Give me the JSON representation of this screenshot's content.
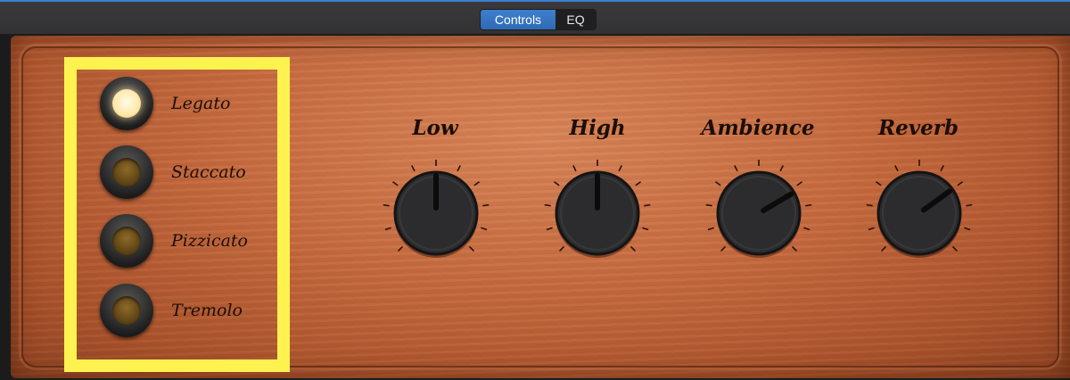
{
  "tabs": [
    {
      "label": "Controls",
      "active": true
    },
    {
      "label": "EQ",
      "active": false
    }
  ],
  "articulations": [
    {
      "label": "Legato",
      "on": true
    },
    {
      "label": "Staccato",
      "on": false
    },
    {
      "label": "Pizzicato",
      "on": false
    },
    {
      "label": "Tremolo",
      "on": false
    }
  ],
  "knobs": [
    {
      "label": "Low",
      "value": 0.5
    },
    {
      "label": "High",
      "value": 0.5
    },
    {
      "label": "Ambience",
      "value": 0.72
    },
    {
      "label": "Reverb",
      "value": 0.7
    }
  ],
  "colors": {
    "highlight": "#fdf250",
    "accent": "#3b7fd1",
    "wood": "#c56a3f"
  }
}
